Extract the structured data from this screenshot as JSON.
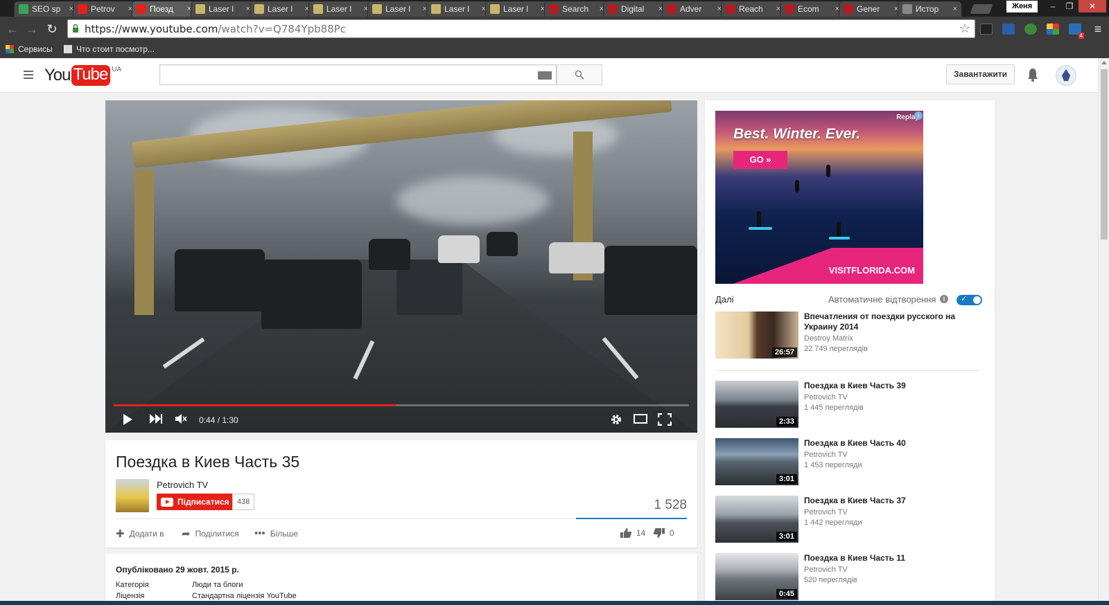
{
  "browser": {
    "tabs": [
      {
        "title": "SEO sp",
        "color": "#3aa35a"
      },
      {
        "title": "Petrov",
        "color": "#e62117"
      },
      {
        "title": "Поезд",
        "color": "#e62117"
      },
      {
        "title": "Laser l",
        "color": "#c9b56a"
      },
      {
        "title": "Laser l",
        "color": "#c9b56a"
      },
      {
        "title": "Laser l",
        "color": "#c9b56a"
      },
      {
        "title": "Laser l",
        "color": "#c9b56a"
      },
      {
        "title": "Laser l",
        "color": "#c9b56a"
      },
      {
        "title": "Laser l",
        "color": "#c9b56a"
      },
      {
        "title": "Search",
        "color": "#b01e23"
      },
      {
        "title": "Digital",
        "color": "#b01e23"
      },
      {
        "title": "Adver",
        "color": "#b01e23"
      },
      {
        "title": "Reach",
        "color": "#b01e23"
      },
      {
        "title": "Ecom",
        "color": "#b01e23"
      },
      {
        "title": "Gener",
        "color": "#b01e23"
      },
      {
        "title": "Истор",
        "color": "#888888"
      }
    ],
    "active_tab_index": 2,
    "profile_name": "Женя",
    "url_host": "https://www.youtube.com",
    "url_path": "/watch?v=Q784Ypb88Pc",
    "bookmarks": [
      {
        "label": "Сервисы"
      },
      {
        "label": "Что стоит посмотр..."
      }
    ],
    "extension_badge": "4"
  },
  "header": {
    "logo_you": "You",
    "logo_tube": "Tube",
    "country": "UA",
    "search_placeholder": "",
    "upload_label": "Завантажити"
  },
  "player": {
    "time": "0:44 / 1:30",
    "progress": 0.49
  },
  "video": {
    "title": "Поездка в Киев Часть 35",
    "channel": "Petrovich TV",
    "subscribe_label": "Підписатися",
    "subscriber_count": "438",
    "views": "1 528",
    "actions": {
      "add_to": "Додати в",
      "share": "Поділитися",
      "more": "Більше"
    },
    "likes": "14",
    "dislikes": "0",
    "published": "Опубліковано 29 жовт. 2015 р.",
    "meta": [
      {
        "key": "Категорія",
        "value": "Люди та блоги"
      },
      {
        "key": "Ліцензія",
        "value": "Стандартна ліцензія YouTube"
      }
    ]
  },
  "ad": {
    "headline": "Best. Winter. Ever.",
    "cta": "GO »",
    "replay": "Replay",
    "brand": "VISITFLORIDA.COM"
  },
  "sidebar": {
    "up_next_label": "Далі",
    "autoplay_label": "Автоматичне відтворення",
    "autoplay_on": true,
    "up_next": {
      "title": "Впечатления от поездки русского на Украину 2014",
      "channel": "Destroy Matrix",
      "views": "22 749 переглядів",
      "duration": "26:57"
    },
    "recommendations": [
      {
        "title": "Поездка в Киев Часть 39",
        "channel": "Petrovich TV",
        "views": "1 445 переглядів",
        "duration": "2:33"
      },
      {
        "title": "Поездка в Киев Часть 40",
        "channel": "Petrovich TV",
        "views": "1 453 перегляди",
        "duration": "3:01"
      },
      {
        "title": "Поездка в Киев Часть 37",
        "channel": "Petrovich TV",
        "views": "1 442 перегляди",
        "duration": "3:01"
      },
      {
        "title": "Поездка в Киев Часть 11",
        "channel": "Petrovich TV",
        "views": "520 переглядів",
        "duration": "0:45"
      }
    ]
  }
}
